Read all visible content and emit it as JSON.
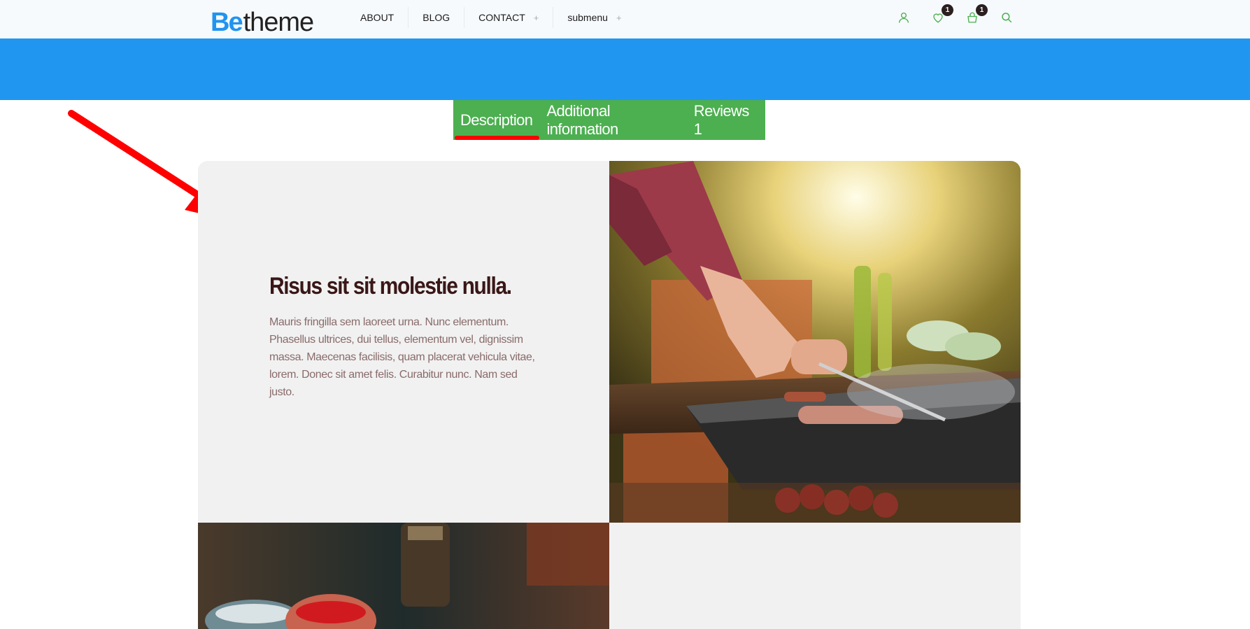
{
  "header": {
    "logo_be": "Be",
    "logo_theme": "theme",
    "nav": [
      {
        "label": "ABOUT",
        "has_submenu": false
      },
      {
        "label": "BLOG",
        "has_submenu": false
      },
      {
        "label": "CONTACT",
        "has_submenu": true
      },
      {
        "label": "submenu",
        "has_submenu": true
      }
    ],
    "submenu_indicator": "+",
    "icons": {
      "account": "user-icon",
      "wishlist": "heart-icon",
      "cart": "bag-icon",
      "search": "search-icon"
    },
    "wishlist_count": "1",
    "cart_count": "1",
    "icon_color": "#4caf50"
  },
  "banner": {
    "color": "#2196f0"
  },
  "tabs": {
    "items": [
      {
        "label": "Description",
        "active": true
      },
      {
        "label": "Additional information",
        "active": false
      },
      {
        "label": "Reviews 1",
        "active": false
      }
    ],
    "bg_color": "#4caf50",
    "active_indicator_color": "#ff0000"
  },
  "content": {
    "heading": "Risus sit sit molestie nulla.",
    "body": "Mauris fringilla sem laoreet urna. Nunc elementum. Phasellus ultrices, dui tellus, elementum vel, dignissim massa. Maecenas facilisis, quam placerat vehicula vitae, lorem. Donec sit amet felis. Curabitur nunc. Nam sed justo.",
    "images": [
      "barbecue-grilling-photo",
      "spices-jars-photo"
    ]
  },
  "annotation": {
    "arrow_color": "#ff0000"
  }
}
